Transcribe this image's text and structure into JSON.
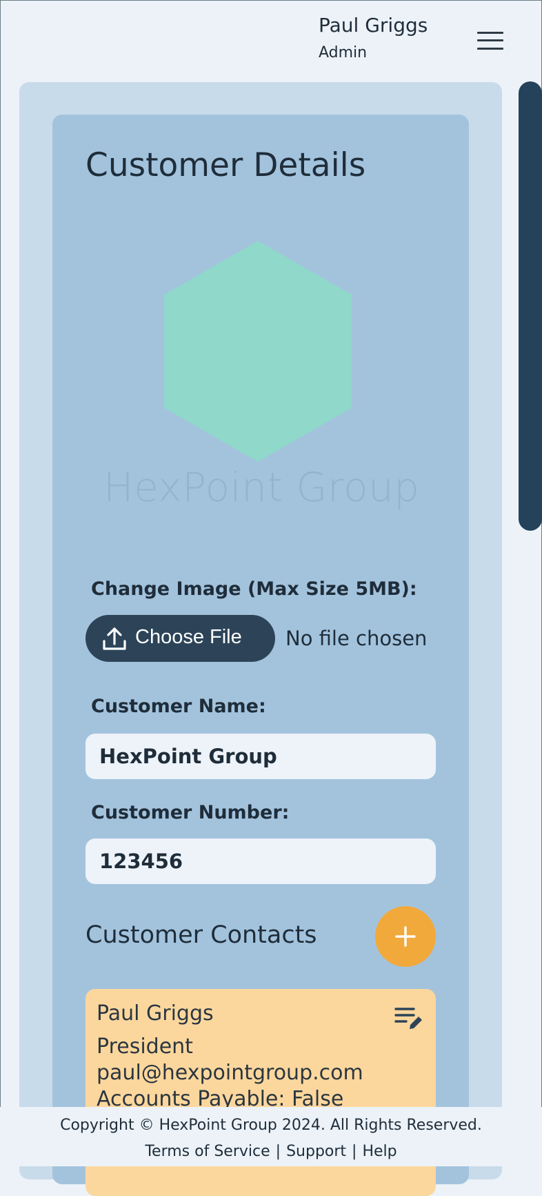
{
  "header": {
    "user_name": "Paul Griggs",
    "user_role": "Admin",
    "menu_icon": "hamburger-menu-icon"
  },
  "customer": {
    "page_title": "Customer Details",
    "logo": {
      "wordmark": "HexPoint Group",
      "hexagon_color": "#8fd8ca",
      "shape": "hexagon-logo"
    },
    "change_image_label": "Change Image (Max Size 5MB):",
    "choose_file_label": "Choose File",
    "choose_file_icon": "upload-icon",
    "file_status": "No file chosen",
    "name_label": "Customer Name:",
    "name_value": "HexPoint Group",
    "number_label": "Customer Number:",
    "number_value": "123456"
  },
  "contacts": {
    "section_title": "Customer Contacts",
    "add_icon": "plus-icon",
    "items": [
      {
        "name": "Paul Griggs",
        "title": "President",
        "email": "paul@hexpointgroup.com",
        "accounts_payable": "Accounts Payable: False",
        "edit_icon": "edit-list-icon"
      }
    ]
  },
  "footer": {
    "copyright": "Copyright © HexPoint Group 2024. All Rights Reserved.",
    "links": [
      "Terms of Service",
      "Support",
      "Help"
    ],
    "separator": "|"
  },
  "colors": {
    "page_bg": "#ecf2f8",
    "outer_panel": "#c8dbea",
    "inner_card": "#a3c3dd",
    "button_dark": "#2d4458",
    "accent_orange": "#f2a93b",
    "contact_card": "#fcd79d",
    "scrollbar": "#24425a"
  }
}
